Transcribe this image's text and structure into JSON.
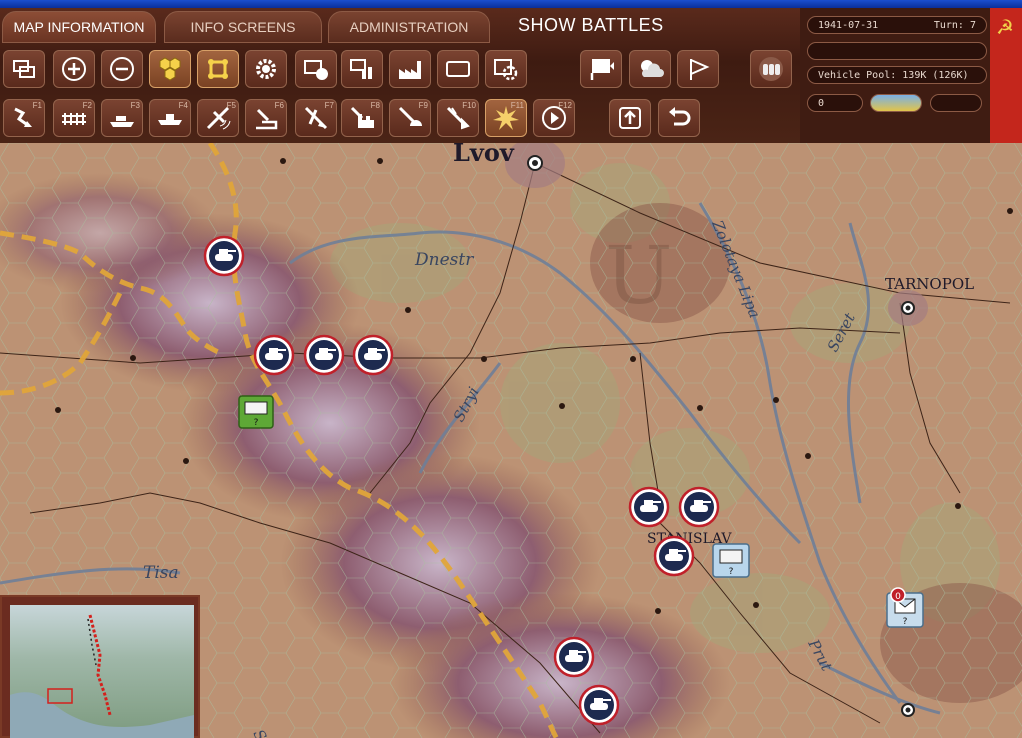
{
  "tabs": [
    "MAP INFORMATION",
    "INFO SCREENS",
    "ADMINISTRATION"
  ],
  "show_battles": "SHOW BATTLES",
  "toolbar_row1": [
    "layers-icon",
    "zoom-in-icon",
    "zoom-out-icon",
    "hex-grid-icon",
    "unit-view-icon",
    "gear-icon",
    "unit-counter-icon",
    "supply-icon",
    "factory-icon",
    "frame-icon",
    "settings-frame-icon",
    "flag-marker-icon",
    "weather-icon",
    "pennant-icon",
    "ammo-icon"
  ],
  "toolbar_row2": [
    {
      "icon": "move-icon",
      "key": "F1"
    },
    {
      "icon": "rail-icon",
      "key": "F2"
    },
    {
      "icon": "naval-icon",
      "key": "F3"
    },
    {
      "icon": "ship-icon",
      "key": "F4"
    },
    {
      "icon": "air-icon",
      "key": "F5"
    },
    {
      "icon": "artillery-icon",
      "key": "F6"
    },
    {
      "icon": "airstrike-icon",
      "key": "F7"
    },
    {
      "icon": "bombard-icon",
      "key": "F8"
    },
    {
      "icon": "paradrop-icon",
      "key": "F9"
    },
    {
      "icon": "air-transfer-icon",
      "key": "F10"
    },
    {
      "icon": "explosion-icon",
      "key": "F11"
    },
    {
      "icon": "next-icon",
      "key": "F12"
    },
    {
      "icon": "upload-icon",
      "key": ""
    },
    {
      "icon": "undo-icon",
      "key": ""
    }
  ],
  "info": {
    "date": "1941-07-31",
    "turn": "Turn: 7",
    "vehicle_pool": "Vehicle Pool: 139K (126K)",
    "points": "0"
  },
  "map_labels": {
    "lvov": "Lvov",
    "tarnopol": "TARNOPOL",
    "stanislav": "STANISLAV",
    "dnestr": "Dnestr",
    "zolotaya_lipa": "Zolotaya Lipa",
    "seret": "Seret",
    "stryi": "Stryi",
    "tisa": "Tisa",
    "prut": "Prut",
    "sa": "S"
  },
  "colors": {
    "chrome": "#4b2416",
    "frontline": "#e0a53a",
    "river": "#6f7f98",
    "unit_ring": "#c0202a"
  }
}
